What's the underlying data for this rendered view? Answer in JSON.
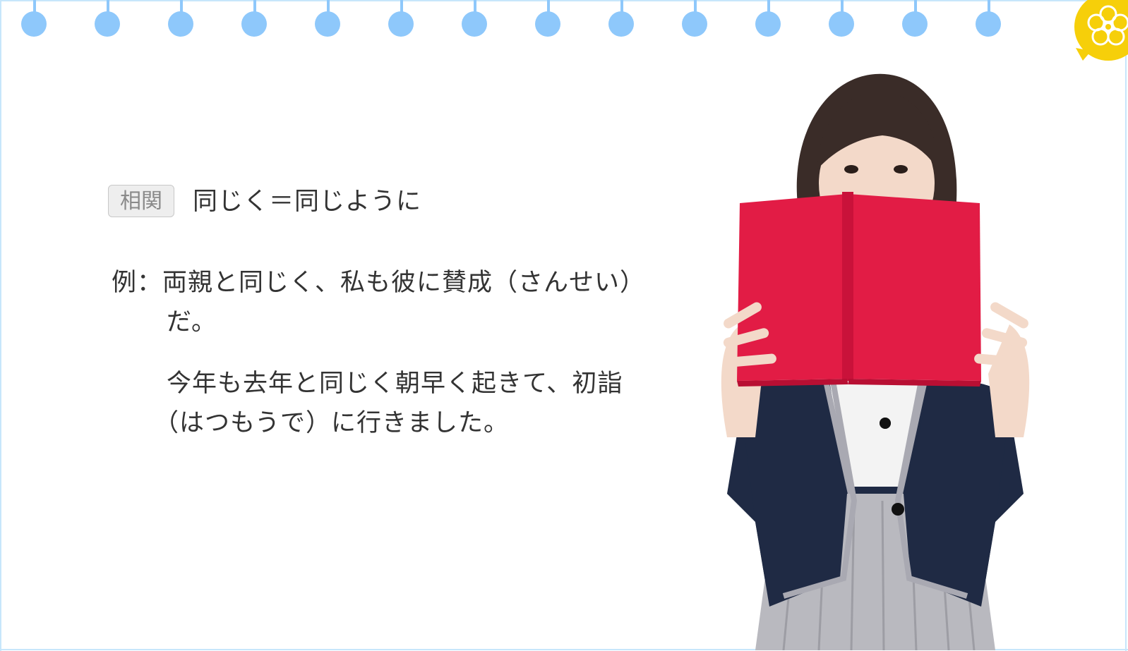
{
  "related": {
    "tag": "相関",
    "text": "同じく＝同じように"
  },
  "examples": {
    "prefix": "例：",
    "line1": "両親と同じく、私も彼に賛成（さんせい）",
    "line2": "だ。",
    "line3": "今年も去年と同じく朝早く起きて、初詣",
    "line4": "（はつもうで）に行きました。"
  },
  "decor": {
    "pin_color": "#8ec8fb",
    "frame_color": "#c7e6fb",
    "badge_color": "#f6cf0a",
    "book_color": "#e21c45",
    "jacket_color": "#1f2a44",
    "skirt_color": "#b9b9bf",
    "badge_icon": "flower-icon"
  }
}
